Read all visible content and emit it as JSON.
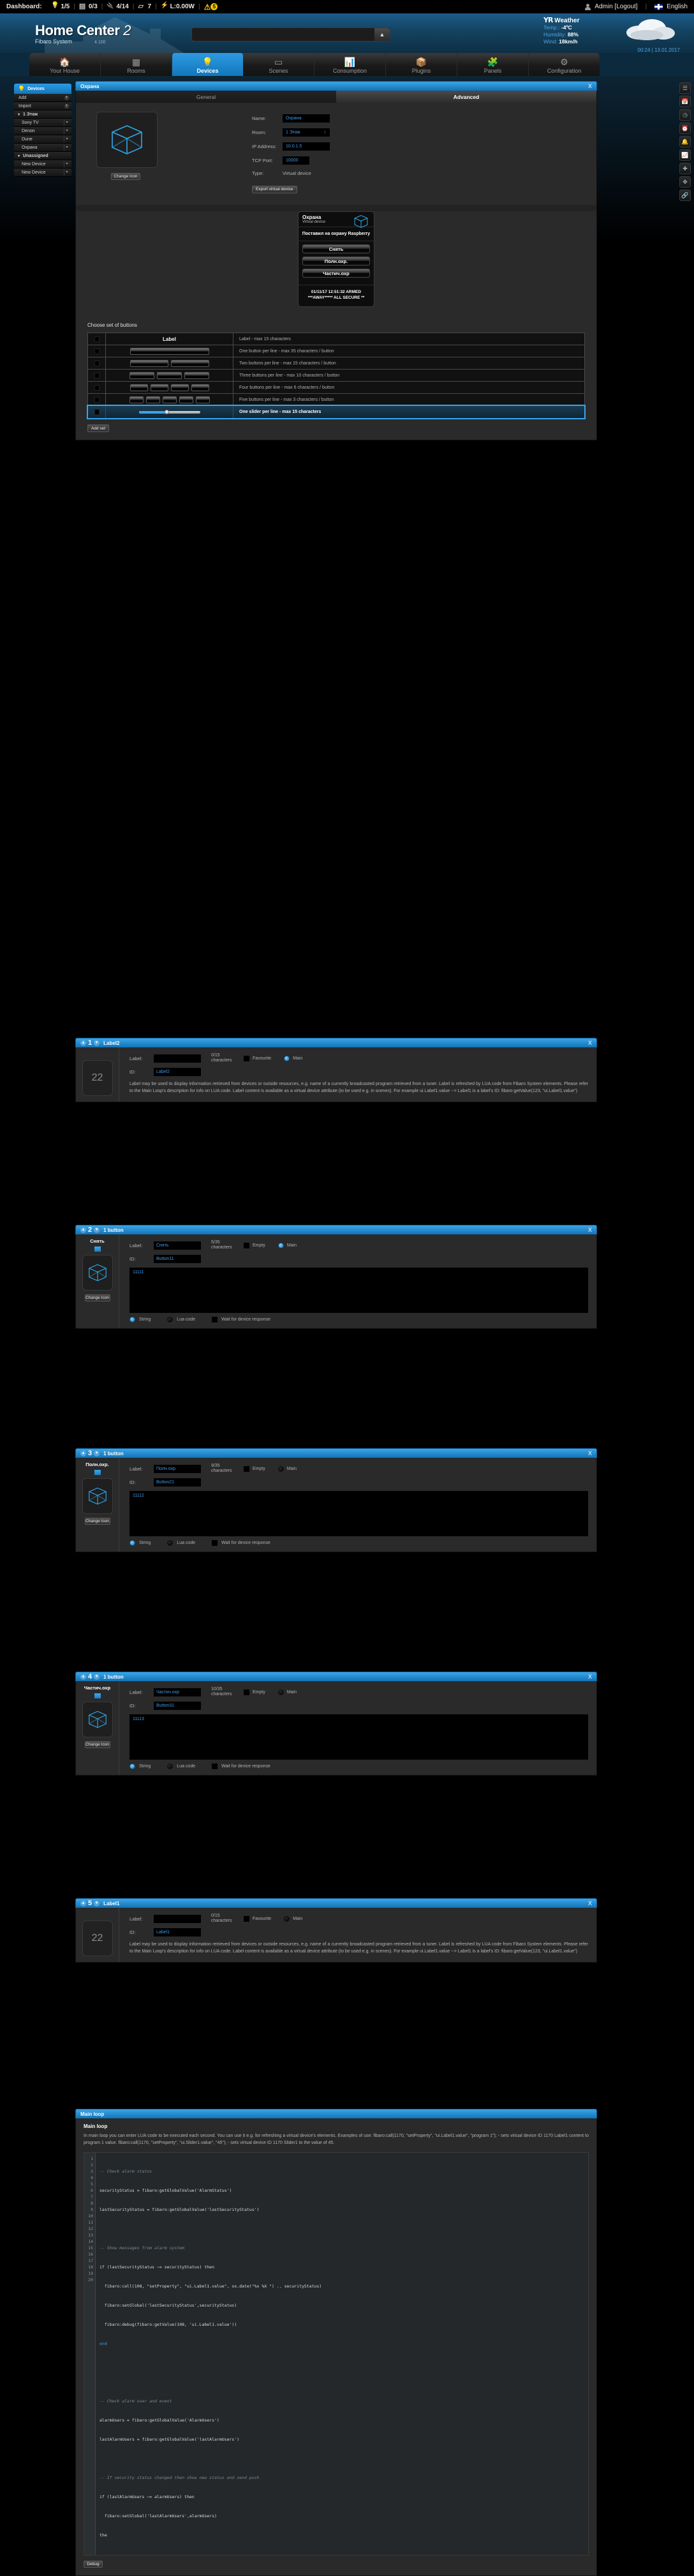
{
  "topbar": {
    "dashboard_label": "Dashboard:",
    "stats": [
      {
        "icon": "bulb-icon",
        "value": "1/5"
      },
      {
        "icon": "blind-icon",
        "value": "0/3"
      },
      {
        "icon": "plug-icon",
        "value": "4/14"
      },
      {
        "icon": "scene-icon",
        "value": "7"
      },
      {
        "icon": "bolt-icon",
        "value": "L:0.00W"
      }
    ],
    "alert_count": "5",
    "user": "Admin [Logout]",
    "language": "English"
  },
  "header": {
    "title": "Home Center",
    "title_mark": "2",
    "subtitle": "Fibaro System",
    "version": "4.100",
    "url_value": "",
    "weather": {
      "brand": "YR",
      "title": "Weather",
      "temp_label": "Temp.:",
      "temp_value": "-4ºC",
      "humidity_label": "Humidity:",
      "humidity_value": "88%",
      "wind_label": "Wind:",
      "wind_value": "18km/h",
      "datetime": "00:24 | 13.01.2017"
    }
  },
  "nav": {
    "tabs": [
      {
        "label": "Your House",
        "icon": "house-icon",
        "active": false
      },
      {
        "label": "Rooms",
        "icon": "rooms-icon",
        "active": false
      },
      {
        "label": "Devices",
        "icon": "bulb-icon",
        "active": true
      },
      {
        "label": "Scenes",
        "icon": "scene-icon",
        "active": false
      },
      {
        "label": "Consumption",
        "icon": "chart-icon",
        "active": false
      },
      {
        "label": "Plugins",
        "icon": "box-icon",
        "active": false
      },
      {
        "label": "Panels",
        "icon": "puzzle-icon",
        "active": false
      },
      {
        "label": "Configuration",
        "icon": "gear-icon",
        "active": false
      }
    ]
  },
  "sidebar": {
    "header": "Devices",
    "items": [
      {
        "label": "Add",
        "type": "action"
      },
      {
        "label": "Import",
        "type": "action"
      },
      {
        "label": "1 Этаж",
        "type": "group"
      },
      {
        "label": "Sony TV",
        "type": "device"
      },
      {
        "label": "Denon",
        "type": "device"
      },
      {
        "label": "Dune",
        "type": "device"
      },
      {
        "label": "Охрана",
        "type": "device"
      },
      {
        "label": "Unassigned",
        "type": "group"
      },
      {
        "label": "New Device",
        "type": "device"
      },
      {
        "label": "New Device",
        "type": "device"
      }
    ]
  },
  "rail": {
    "icons": [
      "list-icon",
      "calendar-icon",
      "clock-icon",
      "alarm-icon",
      "bell-icon",
      "graph-icon",
      "plus-icon",
      "move-icon",
      "link-icon"
    ]
  },
  "device_panel": {
    "title": "Охрана",
    "close": "X",
    "tabs": [
      {
        "label": "General",
        "active": false
      },
      {
        "label": "Advanced",
        "active": true
      }
    ],
    "change_icon_label": "Change Icon",
    "fields": {
      "name_label": "Name:",
      "name_value": "Охрана",
      "room_label": "Room:",
      "room_value": "1 Этаж",
      "ip_label": "IP Address:",
      "ip_value": "10.0.1.5",
      "port_label": "TCP Port:",
      "port_value": "10000",
      "type_label": "Type:",
      "type_value": "Virtual device",
      "export_label": "Export virtual device"
    }
  },
  "vd_preview": {
    "name": "Охрана",
    "subtitle": "Virtual device",
    "status": "Поставил на охрану Raspberry",
    "buttons": [
      "Снять",
      "Полн.охр.",
      "Частич.охр"
    ],
    "footer_line1": "01/11/17 12:51:32 ARMED",
    "footer_line2": "***AWAY***** ALL SECURE **"
  },
  "chooser": {
    "title": "Choose set of buttons",
    "add_set_label": "Add set",
    "rows": [
      {
        "kind": "label",
        "preview_text": "Label",
        "desc": "Label - max 15 characters",
        "selected": false
      },
      {
        "kind": "buttons",
        "count": 1,
        "desc": "One button per line - max 35 characters / button",
        "selected": false
      },
      {
        "kind": "buttons",
        "count": 2,
        "desc": "Two buttons per line - max 15 characters / button",
        "selected": false
      },
      {
        "kind": "buttons",
        "count": 3,
        "desc": "Three buttons per line - max 10 characters / button",
        "selected": false
      },
      {
        "kind": "buttons",
        "count": 4,
        "desc": "Four buttons per line - max 6 characters / button",
        "selected": false
      },
      {
        "kind": "buttons",
        "count": 5,
        "desc": "Five buttons per line - max 3 characters / button",
        "selected": false
      },
      {
        "kind": "slider",
        "desc": "One slider per line - max 15 characters",
        "selected": true
      }
    ]
  },
  "label_help": "Label may be used to display information retrieved from devices or outside resources, e.g. name of a currently broadcasted program retrieved from a tuner. Label is refreshed by LUA code from Fibaro System elements. Please refer to the Main Loop's description for info on LUA code. Label content is available as a virtual device attribute (to be used e.g. in scenes). For example ui.Label1.value --> Label1 is a label's ID: fibaro:getValue(123, \"ui.Label1.value\")",
  "elements": [
    {
      "num": "1",
      "type_label": "Label2",
      "close": "X",
      "preview_caption": "",
      "preview_value": "22",
      "label_field_label": "Label:",
      "label_value": "",
      "charcount": "0/15 characters",
      "checkbox_label": "Favourite",
      "main_label": "Main",
      "main_on": true,
      "id_label": "ID:",
      "id_value": "Label2",
      "has_help": true,
      "has_code": false,
      "has_icon": false
    },
    {
      "num": "2",
      "type_label": "1 button",
      "close": "X",
      "preview_caption": "Снять",
      "preview_value": "",
      "label_field_label": "Label:",
      "label_value": "Снять",
      "charcount": "5/35 characters",
      "checkbox_label": "Empty",
      "main_label": "Main",
      "main_on": true,
      "id_label": "ID:",
      "id_value": "Button11",
      "code_value": "11111",
      "has_help": false,
      "has_code": true,
      "has_icon": true,
      "change_icon_label": "Change Icon",
      "radios": {
        "string": "String",
        "lua": "Lua code",
        "wait": "Wait for device response"
      }
    },
    {
      "num": "3",
      "type_label": "1 button",
      "close": "X",
      "preview_caption": "Полн.охр.",
      "preview_value": "",
      "label_field_label": "Label:",
      "label_value": "Полн.охр.",
      "charcount": "9/35 characters",
      "checkbox_label": "Empty",
      "main_label": "Main",
      "main_on": false,
      "id_label": "ID:",
      "id_value": "Button21",
      "code_value": "11112",
      "has_help": false,
      "has_code": true,
      "has_icon": true,
      "change_icon_label": "Change Icon",
      "radios": {
        "string": "String",
        "lua": "Lua code",
        "wait": "Wait for device response"
      }
    },
    {
      "num": "4",
      "type_label": "1 button",
      "close": "X",
      "preview_caption": "Частич.охр",
      "preview_value": "",
      "label_field_label": "Label:",
      "label_value": "Частич.охр",
      "charcount": "10/35 characters",
      "checkbox_label": "Empty",
      "main_label": "Main",
      "main_on": false,
      "id_label": "ID:",
      "id_value": "Button31",
      "code_value": "11113",
      "has_help": false,
      "has_code": true,
      "has_icon": true,
      "change_icon_label": "Change Icon",
      "radios": {
        "string": "String",
        "lua": "Lua code",
        "wait": "Wait for device response"
      }
    },
    {
      "num": "5",
      "type_label": "Label1",
      "close": "X",
      "preview_caption": "",
      "preview_value": "22",
      "label_field_label": "Label:",
      "label_value": "",
      "charcount": "0/15 characters",
      "checkbox_label": "Favourite",
      "main_label": "Main",
      "main_on": false,
      "id_label": "ID:",
      "id_value": "Label1",
      "has_help": true,
      "has_code": false,
      "has_icon": false
    }
  ],
  "main_loop": {
    "panel_title": "Main loop",
    "heading": "Main loop",
    "description": "In main loop you can enter LUA code to be executed each second. You can use it e.g. for refreshing a virtual device's elements. Examples of use: fibaro:call(1170, \"setProperty\", \"ui.Label1.value\", \"program 1\"); - sets virtual device ID 1170 Label1 content to program 1 value. fibaro:call(1170, \"setProperty\", \"ui.Slider1.value\", \"45\"); - sets virtual device ID 1170 Slider1 to the value of 45.",
    "debug_label": "Debug",
    "code_lines": [
      "-- Check alarm status",
      "securityStatus = fibaro:getGlobalValue('AlarmStatus')",
      "lastSecurityStatus = fibaro:getGlobalValue('lastSecurityStatus')",
      "",
      "-- Show messages from alarm system",
      "if (lastSecurityStatus ~= securityStatus) then",
      "  fibaro:call(108, \"setProperty\", \"ui.Label1.value\", os.date(\"%x %X \") .. securityStatus)",
      "  fibaro:setGlobal('lastSecurityStatus',securityStatus)",
      "  fibaro:debug(fibaro:getValue(108, 'ui.Label1.value'))",
      "end",
      "",
      "",
      "-- Check alarm user and event",
      "alarmUsers = fibaro:getGlobalValue('AlarmUsers')",
      "lastAlarmUsers = fibaro:getGlobalValue('lastAlarmUsers')",
      "",
      "-- If security status changed then show new status and send push",
      "if (lastAlarmUsers ~= alarmUsers) then",
      "  fibaro:setGlobal('lastAlarmUsers',alarmUsers)",
      "the"
    ]
  }
}
